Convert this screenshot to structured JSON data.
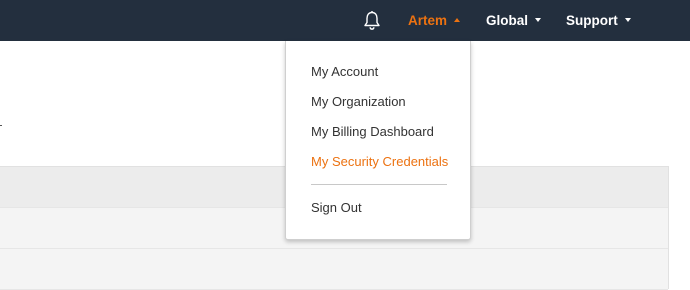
{
  "header": {
    "notifications_icon": "bell-icon",
    "user_menu": {
      "label": "Artem",
      "state": "open"
    },
    "region_menu": {
      "label": "Global"
    },
    "support_menu": {
      "label": "Support"
    }
  },
  "account_dropdown": {
    "items": [
      {
        "label": "My Account"
      },
      {
        "label": "My Organization"
      },
      {
        "label": "My Billing Dashboard"
      },
      {
        "label": "My Security Credentials",
        "highlighted": true
      }
    ],
    "sign_out_label": "Sign Out"
  },
  "colors": {
    "topbar_bg": "#232f3e",
    "accent": "#ec7211",
    "menu_text": "#333333"
  }
}
